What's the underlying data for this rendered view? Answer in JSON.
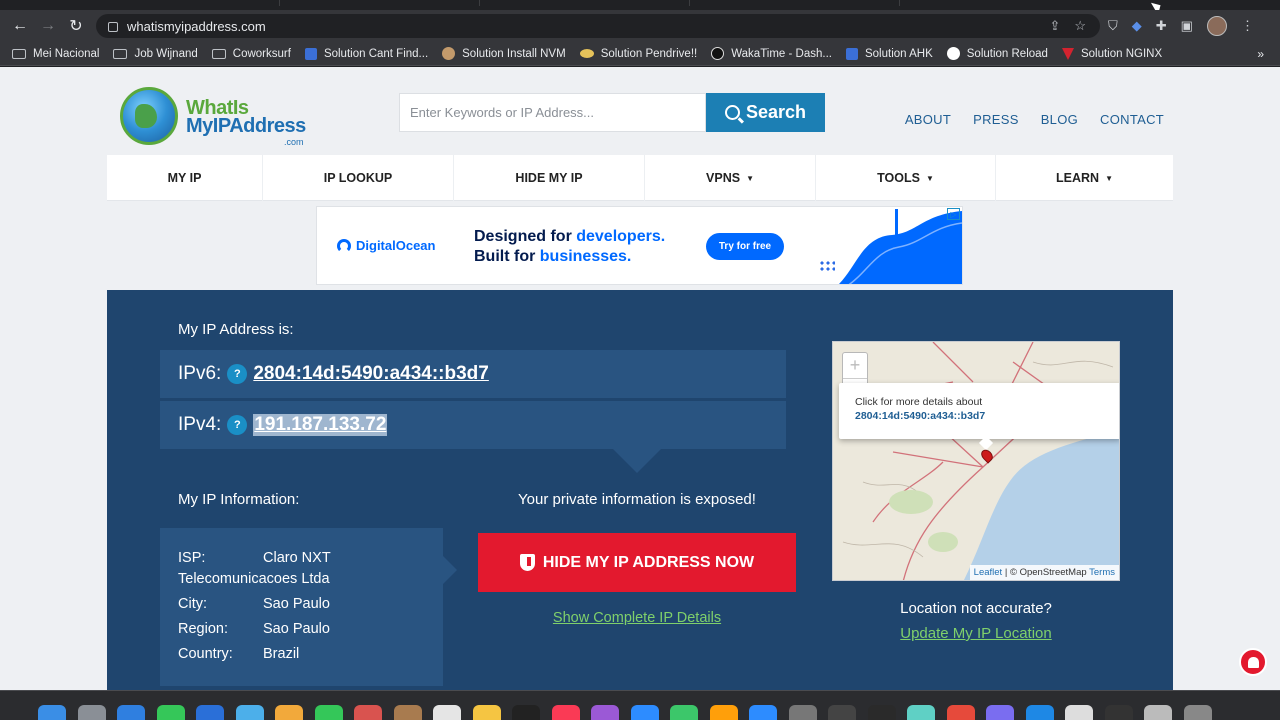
{
  "browser": {
    "url": "whatismyipaddress.com"
  },
  "bookmarks": [
    {
      "label": "Mei Nacional",
      "icon": "folder"
    },
    {
      "label": "Job Wijnand",
      "icon": "folder"
    },
    {
      "label": "Coworksurf",
      "icon": "folder"
    },
    {
      "label": "Solution Cant Find...",
      "icon": "sq"
    },
    {
      "label": "Solution Install NVM",
      "icon": "circ"
    },
    {
      "label": "Solution Pendrive!!",
      "icon": "oval"
    },
    {
      "label": "WakaTime - Dash...",
      "icon": "dark"
    },
    {
      "label": "Solution AHK",
      "icon": "sq"
    },
    {
      "label": "Solution Reload",
      "icon": "gh"
    },
    {
      "label": "Solution NGINX",
      "icon": "tri"
    }
  ],
  "header": {
    "logo_line1": "WhatIs",
    "logo_line2": "MyIPAddress",
    "logo_suffix": ".com",
    "search_placeholder": "Enter Keywords or IP Address...",
    "search_button": "Search",
    "links": [
      "ABOUT",
      "PRESS",
      "BLOG",
      "CONTACT"
    ]
  },
  "nav": {
    "items": [
      {
        "label": "MY IP",
        "dropdown": false
      },
      {
        "label": "IP LOOKUP",
        "dropdown": false
      },
      {
        "label": "HIDE MY IP",
        "dropdown": false
      },
      {
        "label": "VPNS",
        "dropdown": true
      },
      {
        "label": "TOOLS",
        "dropdown": true
      },
      {
        "label": "LEARN",
        "dropdown": true
      }
    ],
    "caret": "▼"
  },
  "ad": {
    "brand": "DigitalOcean",
    "line1_a": "Designed for ",
    "line1_b": "developers.",
    "line2_a": "Built for ",
    "line2_b": "businesses.",
    "cta": "Try for free",
    "brand_color": "#0069ff"
  },
  "ip": {
    "heading": "My IP Address is:",
    "ipv6_label": "IPv6:",
    "ipv6": "2804:14d:5490:a434::b3d7",
    "ipv4_label": "IPv4:",
    "ipv4": "191.187.133.72",
    "help": "?"
  },
  "info": {
    "heading": "My IP Information:",
    "isp_key": "ISP:",
    "isp_value": "Claro NXT Telecomunicacoes Ltda",
    "city_key": "City:",
    "city_value": "Sao Paulo",
    "region_key": "Region:",
    "region_value": "Sao Paulo",
    "country_key": "Country:",
    "country_value": "Brazil"
  },
  "cta": {
    "exposed_text": "Your private information is exposed!",
    "hide_button": "HIDE MY IP ADDRESS NOW",
    "details_link": "Show Complete IP Details",
    "button_color": "#e3192e"
  },
  "map": {
    "zoom_in": "+",
    "zoom_out": "−",
    "popup_text": "Click for more details about",
    "popup_ip": "2804:14d:5490:a434::b3d7",
    "attrib_leaflet": "Leaflet",
    "attrib_osm": " | © OpenStreetMap ",
    "attrib_terms": "Terms",
    "location_question": "Location not accurate?",
    "update_link": "Update My IP Location"
  },
  "colors": {
    "panel": "#1f456e",
    "panel_box": "#295481",
    "link_green": "#7fd06b",
    "primary_blue": "#1c7fb4"
  }
}
